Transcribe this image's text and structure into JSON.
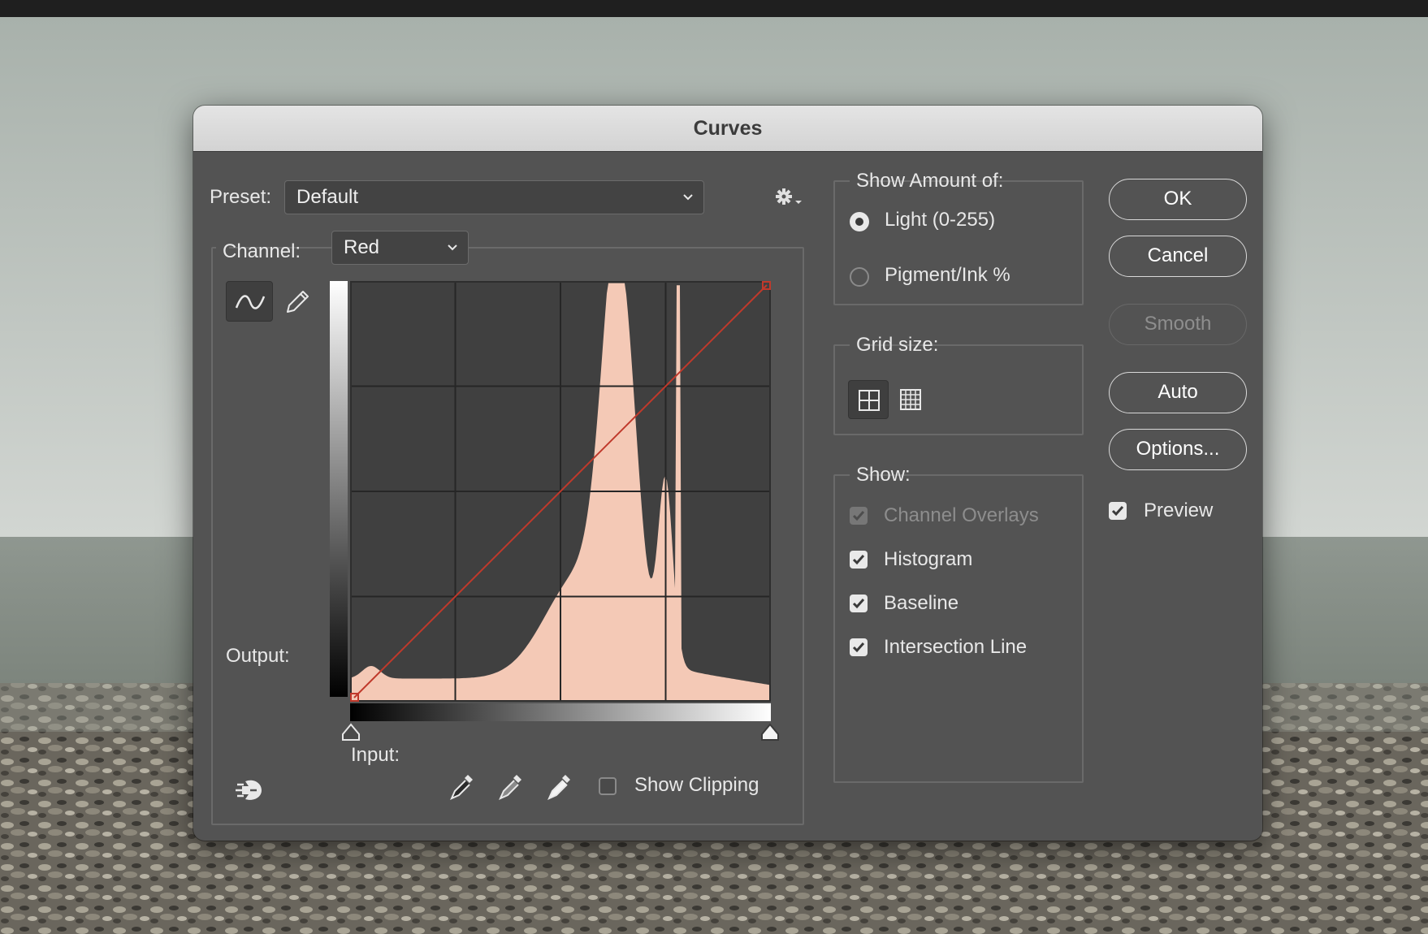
{
  "dialog": {
    "title": "Curves"
  },
  "preset": {
    "label": "Preset:",
    "value": "Default"
  },
  "channel": {
    "label": "Channel:",
    "value": "Red"
  },
  "graph": {
    "output_label": "Output:",
    "input_label": "Input:",
    "curve_color": "#c0392b",
    "histogram_color": "#f4c9b6",
    "grid_divisions": 4
  },
  "show_clipping": {
    "label": "Show Clipping",
    "checked": false
  },
  "show_amount": {
    "legend": "Show Amount of:",
    "options": [
      {
        "label": "Light  (0-255)",
        "selected": true
      },
      {
        "label": "Pigment/Ink %",
        "selected": false
      }
    ]
  },
  "grid_size": {
    "legend": "Grid size:",
    "selected": "simple"
  },
  "show": {
    "legend": "Show:",
    "items": [
      {
        "label": "Channel Overlays",
        "checked": true,
        "disabled": true
      },
      {
        "label": "Histogram",
        "checked": true,
        "disabled": false
      },
      {
        "label": "Baseline",
        "checked": true,
        "disabled": false
      },
      {
        "label": "Intersection Line",
        "checked": true,
        "disabled": false
      }
    ]
  },
  "buttons": {
    "ok": "OK",
    "cancel": "Cancel",
    "smooth": "Smooth",
    "auto": "Auto",
    "options": "Options..."
  },
  "preview": {
    "label": "Preview",
    "checked": true
  },
  "icons": {
    "settings": "gear-icon",
    "curve_tool": "curve-point-icon",
    "pencil_tool": "pencil-icon",
    "on_image_tool": "on-image-adjust-icon",
    "eyedroppers": [
      "black-point-eyedropper-icon",
      "gray-point-eyedropper-icon",
      "white-point-eyedropper-icon"
    ]
  }
}
